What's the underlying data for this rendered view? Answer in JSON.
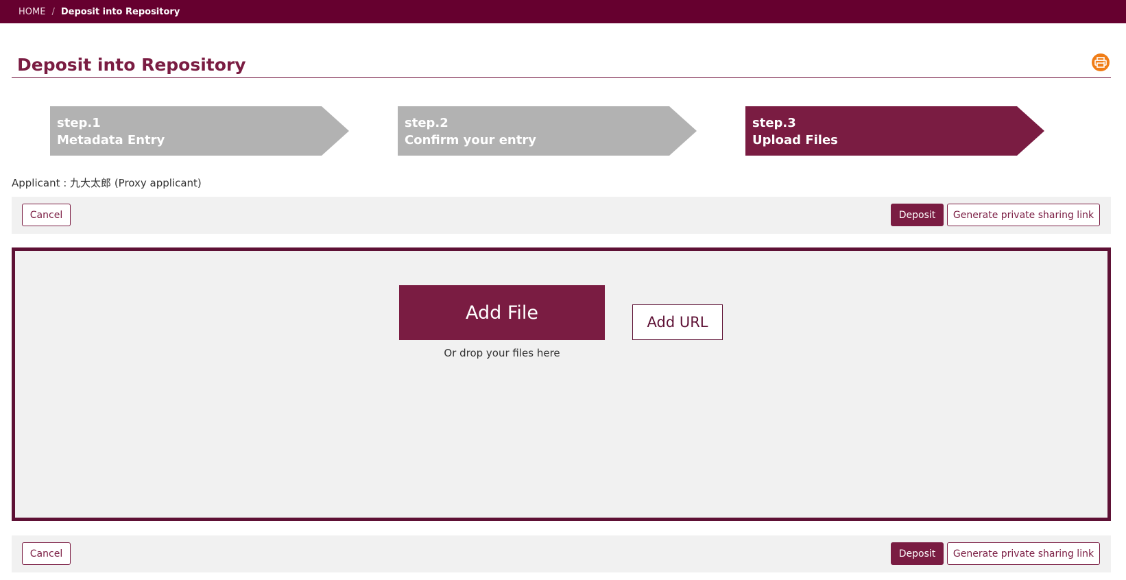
{
  "breadcrumb": {
    "home": "HOME",
    "separator": "/",
    "current": "Deposit into Repository"
  },
  "page": {
    "title": "Deposit into Repository",
    "print_icon": "printer-icon"
  },
  "steps": [
    {
      "number": "step.1",
      "label": "Metadata Entry",
      "state": "inactive"
    },
    {
      "number": "step.2",
      "label": "Confirm your entry",
      "state": "inactive"
    },
    {
      "number": "step.3",
      "label": "Upload Files",
      "state": "active"
    }
  ],
  "applicant": "Applicant : 九大太郎 (Proxy applicant)",
  "actions": {
    "cancel": "Cancel",
    "deposit": "Deposit",
    "share": "Generate private sharing link"
  },
  "upload": {
    "add_file": "Add File",
    "drop_hint": "Or drop your files here",
    "add_url": "Add URL"
  },
  "colors": {
    "brand": "#66002f",
    "accent": "#7a1c42",
    "step_inactive": "#b2b2b2",
    "print_icon": "#f07d17",
    "panel": "#f1f1f1"
  }
}
